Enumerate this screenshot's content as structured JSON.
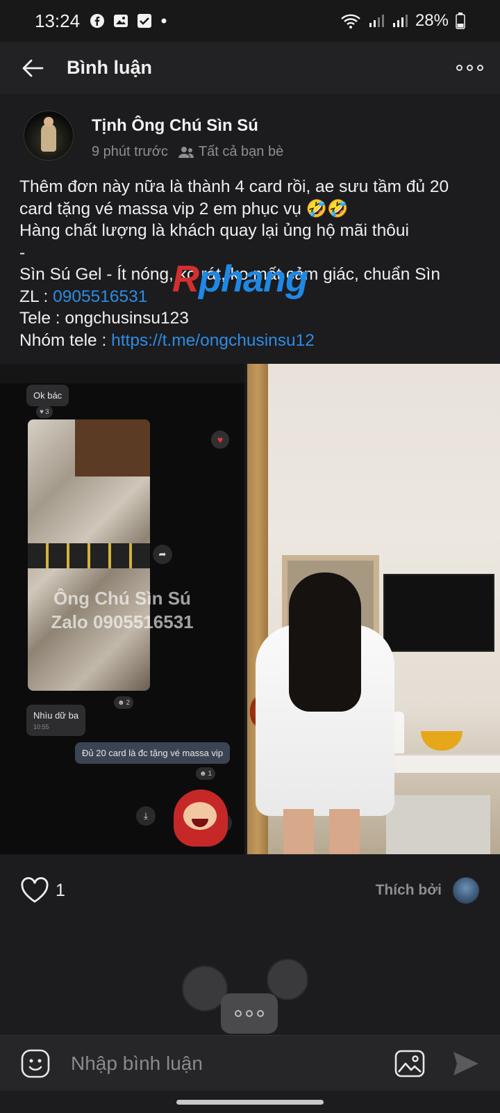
{
  "status_bar": {
    "time": "13:24",
    "battery": "28%",
    "icons": [
      "facebook-icon",
      "gallery-icon",
      "checkbox-icon",
      "dot-icon",
      "wifi-icon",
      "signal-icon",
      "battery-icon"
    ]
  },
  "header": {
    "title": "Bình luận",
    "back_icon": "arrow-left-icon",
    "more_icon": "more-horizontal-icon"
  },
  "post": {
    "author_name": "Tịnh Ông Chú Sìn Sú",
    "time_ago": "9 phút trước",
    "audience": "Tất cả bạn bè",
    "text_lines": [
      "Thêm đơn này nữa là thành 4 card rồi, ae sưu tầm đủ 20",
      "card tặng vé massa vip 2 em phục vụ 🤣🤣",
      "Hàng chất lượng là khách quay lại ủng hộ mãi thôui",
      "-",
      "Sìn Sú Gel - Ít nóng, ko rát, ko mất cảm giác, chuẩn Sìn"
    ],
    "zl_label": "ZL : ",
    "zl_value": "0905516531",
    "tele_line": "Tele : ongchusinsu123",
    "group_label": "Nhóm tele : ",
    "group_link": "https://t.me/ongchusinsu12"
  },
  "images": {
    "chat": {
      "msg_ok": "Ok bác",
      "msg_ok_react": "3",
      "photo_react": "2",
      "watermark_line1": "Ông Chú Sìn Sú",
      "watermark_line2": "Zalo 0905516531",
      "msg_nhiu": "Nhìu dữ ba",
      "msg_nhiu_time": "10:55",
      "msg_own": "Đủ 20 card là đc tặng vé massa vip",
      "msg_own_react": "1"
    },
    "brand_watermark": {
      "part1": "R",
      "part2": "phang"
    }
  },
  "reactions": {
    "like_count": "1",
    "liked_by_label": "Thích bởi"
  },
  "comment_bar": {
    "placeholder": "Nhập bình luận",
    "emoji_icon": "emoji-icon",
    "photo_icon": "image-icon",
    "send_icon": "send-icon"
  },
  "colors": {
    "background": "#1c1c1e",
    "link": "#2d8ce5",
    "secondary_text": "#8e8e93"
  }
}
